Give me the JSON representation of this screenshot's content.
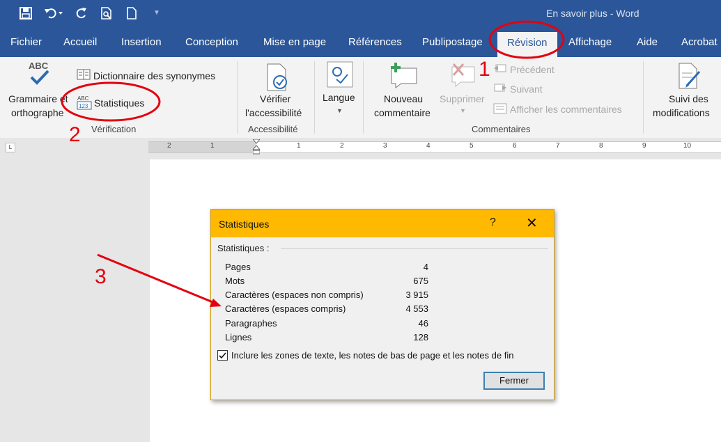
{
  "window": {
    "title": "En savoir plus  -  Word"
  },
  "ribbon_tabs": [
    "Fichier",
    "Accueil",
    "Insertion",
    "Conception",
    "Mise en page",
    "Références",
    "Publipostage",
    "Révision",
    "Affichage",
    "Aide",
    "Acrobat"
  ],
  "active_tab": "Révision",
  "ribbon": {
    "grammaire_line1": "Grammaire et",
    "grammaire_line2": "orthographe",
    "abc_label": "ABC",
    "dictionnaire": "Dictionnaire des synonymes",
    "statistiques": "Statistiques",
    "group_verification": "Vérification",
    "verifier_line1": "Vérifier",
    "verifier_line2": "l'accessibilité",
    "group_accessibilite": "Accessibilité",
    "langue": "Langue",
    "nouveau_line1": "Nouveau",
    "nouveau_line2": "commentaire",
    "supprimer": "Supprimer",
    "precedent": "Précédent",
    "suivant": "Suivant",
    "afficher_commentaires": "Afficher les commentaires",
    "group_commentaires": "Commentaires",
    "suivi_line1": "Suivi des",
    "suivi_line2": "modifications"
  },
  "ruler_numbers": [
    "2",
    "1",
    "1",
    "2",
    "3",
    "4",
    "5",
    "6",
    "7",
    "8",
    "9",
    "10"
  ],
  "dialog": {
    "title": "Statistiques",
    "help": "?",
    "close": "✕",
    "section": "Statistiques :",
    "rows": [
      {
        "label": "Pages",
        "value": "4"
      },
      {
        "label": "Mots",
        "value": "675"
      },
      {
        "label": "Caractères (espaces non compris)",
        "value": "3 915"
      },
      {
        "label": "Caractères (espaces compris)",
        "value": "4 553"
      },
      {
        "label": "Paragraphes",
        "value": "46"
      },
      {
        "label": "Lignes",
        "value": "128"
      }
    ],
    "checkbox_label": "Inclure les zones de texte, les notes de bas de page et les notes de fin",
    "checkbox_checked": true,
    "button": "Fermer"
  },
  "annotations": {
    "n1": "1",
    "n2": "2",
    "n3": "3"
  },
  "colors": {
    "word_blue": "#2b579a",
    "dialog_title": "#ffb900",
    "annotation_red": "#e3000f"
  },
  "icons": [
    "save-icon",
    "undo-icon",
    "redo-icon",
    "print-preview-icon",
    "new-document-icon",
    "customize-icon"
  ]
}
